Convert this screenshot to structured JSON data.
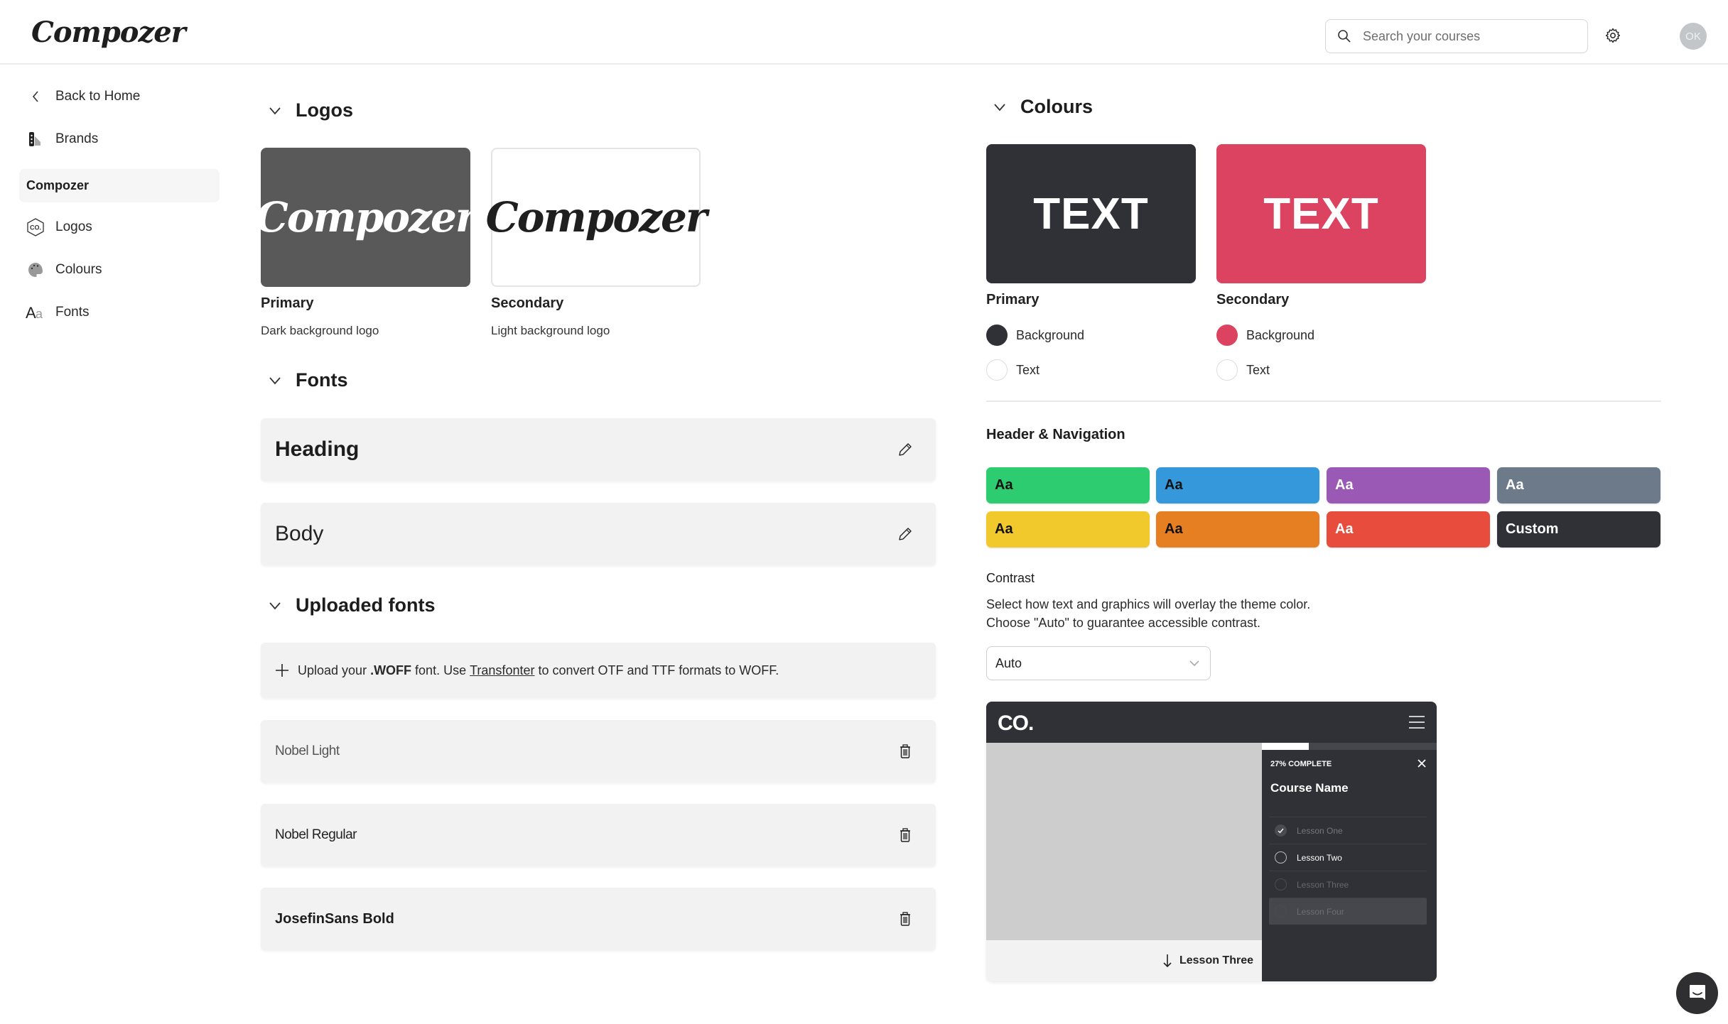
{
  "header": {
    "app_logo": "Compozer",
    "search": {
      "placeholder": "Search your courses",
      "value": "",
      "icon": "search-icon"
    },
    "settings_icon": "gear-icon",
    "avatar_initials": "OK"
  },
  "sidebar": {
    "back": {
      "label": "Back to Home",
      "icon": "chevron-left-icon"
    },
    "brands": {
      "label": "Brands",
      "icon": "swatch-book-icon"
    },
    "group_label": "Compozer",
    "items": [
      {
        "label": "Logos",
        "icon": "co-hexagon-icon"
      },
      {
        "label": "Colours",
        "icon": "palette-icon"
      },
      {
        "label": "Fonts",
        "icon": "font-aa-icon"
      }
    ]
  },
  "logos": {
    "heading": "Logos",
    "cards": [
      {
        "title": "Primary",
        "subtitle": "Dark background logo",
        "logo_text": "Compozer",
        "background": "#595959"
      },
      {
        "title": "Secondary",
        "subtitle": "Light background logo",
        "logo_text": "Compozer",
        "background": "#ffffff"
      }
    ]
  },
  "fonts": {
    "heading": "Fonts",
    "rows": [
      {
        "label": "Heading",
        "action_icon": "pencil-icon"
      },
      {
        "label": "Body",
        "action_icon": "pencil-icon"
      }
    ]
  },
  "uploaded_fonts": {
    "heading": "Uploaded fonts",
    "upload": {
      "prefix": "Upload your ",
      "format": ".WOFF",
      "middle": " font. Use ",
      "link": "Transfonter",
      "suffix": " to convert OTF and TTF formats to WOFF."
    },
    "fonts": [
      {
        "name": "Nobel Light",
        "action_icon": "trash-icon"
      },
      {
        "name": "Nobel Regular",
        "action_icon": "trash-icon"
      },
      {
        "name": "JosefinSans Bold",
        "action_icon": "trash-icon"
      }
    ]
  },
  "colours": {
    "heading": "Colours",
    "swatches": [
      {
        "title": "Primary",
        "sample_text": "TEXT",
        "background": "#303136",
        "text_color": "#ffffff",
        "options": [
          "Background",
          "Text"
        ]
      },
      {
        "title": "Secondary",
        "sample_text": "TEXT",
        "background": "#dc4360",
        "text_color": "#ffffff",
        "options": [
          "Background",
          "Text"
        ]
      }
    ],
    "header_nav": {
      "label": "Header & Navigation",
      "tiles": [
        {
          "label": "Aa",
          "bg": "#2ecc71",
          "fg": "#111111"
        },
        {
          "label": "Aa",
          "bg": "#3498db",
          "fg": "#111111"
        },
        {
          "label": "Aa",
          "bg": "#9b59b6",
          "fg": "#ffffff"
        },
        {
          "label": "Aa",
          "bg": "#6c7a89",
          "fg": "#ffffff"
        },
        {
          "label": "Aa",
          "bg": "#f1c92d",
          "fg": "#111111"
        },
        {
          "label": "Aa",
          "bg": "#e67e22",
          "fg": "#111111"
        },
        {
          "label": "Aa",
          "bg": "#e74c3c",
          "fg": "#ffffff"
        },
        {
          "label": "Custom",
          "bg": "#303136",
          "fg": "#ffffff"
        }
      ]
    },
    "contrast": {
      "label": "Contrast",
      "description_line1": "Select how text and graphics will overlay the theme color.",
      "description_line2": "Choose \"Auto\" to guarantee accessible contrast.",
      "selected": "Auto"
    }
  },
  "preview": {
    "logo": "CO.",
    "menu_icon": "hamburger-icon",
    "progress_percent": 27,
    "progress_label": "27% COMPLETE",
    "course_name": "Course Name",
    "lessons": [
      {
        "label": "Lesson One",
        "state": "done"
      },
      {
        "label": "Lesson Two",
        "state": "current"
      },
      {
        "label": "Lesson Three",
        "state": "locked"
      },
      {
        "label": "Lesson Four",
        "state": "active"
      }
    ],
    "next_label": "Lesson Three"
  },
  "chat": {
    "icon": "chat-icon"
  }
}
